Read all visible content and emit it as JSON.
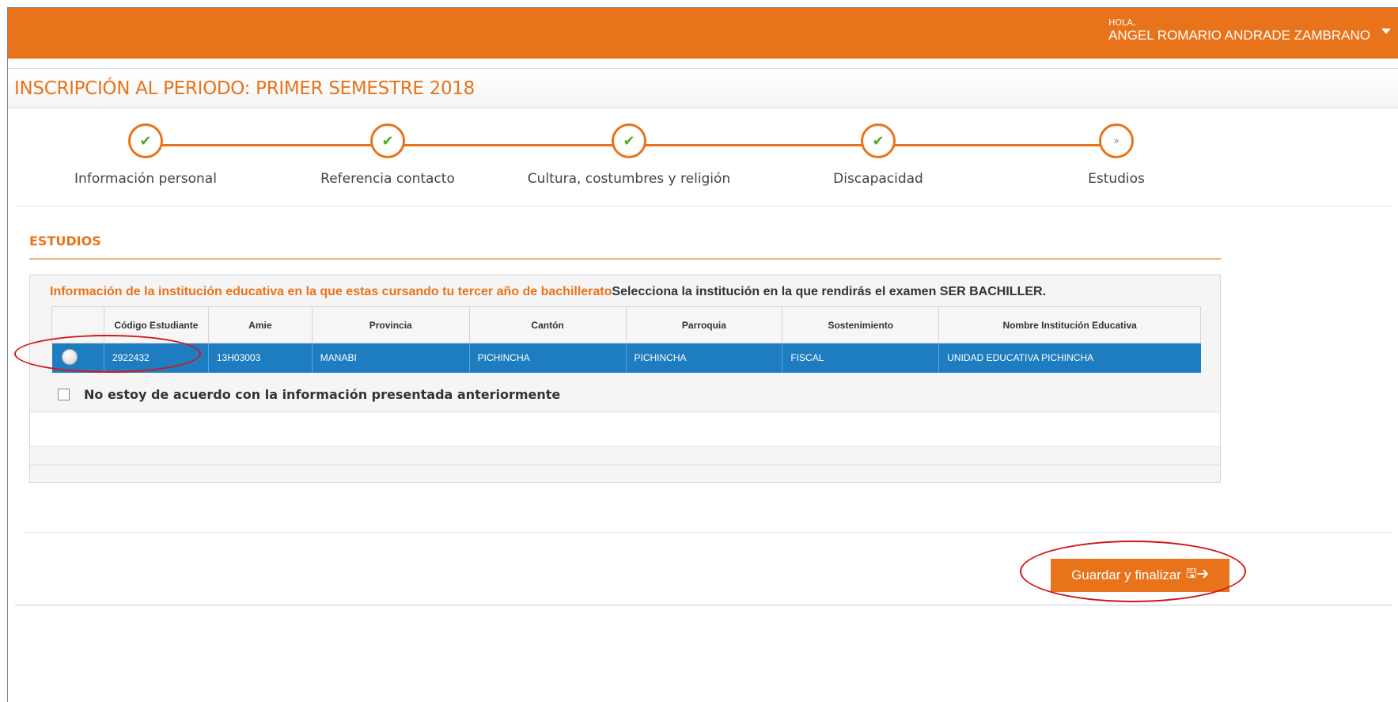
{
  "header": {
    "greeting": "HOLA,",
    "user_name": "ANGEL ROMARIO ANDRADE ZAMBRANO",
    "caret_icon": "caret-down-icon"
  },
  "page": {
    "title": "INSCRIPCIÓN AL PERIODO: PRIMER SEMESTRE 2018"
  },
  "wizard": {
    "steps": [
      {
        "label": "Información personal",
        "state": "done",
        "icon": "check-icon",
        "glyph": "✔"
      },
      {
        "label": "Referencia contacto",
        "state": "done",
        "icon": "check-icon",
        "glyph": "✔"
      },
      {
        "label": "Cultura, costumbres y religión",
        "state": "done",
        "icon": "check-icon",
        "glyph": "✔"
      },
      {
        "label": "Discapacidad",
        "state": "done",
        "icon": "check-icon",
        "glyph": "✔"
      },
      {
        "label": "Estudios",
        "state": "current",
        "icon": "chevron-double-right-icon",
        "glyph": "»"
      }
    ]
  },
  "section": {
    "title": "ESTUDIOS",
    "heading_orange": "Información de la institución educativa en la que estas cursando tu tercer año de bachillerato",
    "heading_dark": "Selecciona la institución en la que rendirás el examen SER BACHILLER."
  },
  "table": {
    "columns": [
      "",
      "Código Estudiante",
      "Amie",
      "Provincia",
      "Cantón",
      "Parroquia",
      "Sostenimiento",
      "Nombre Institución Educativa"
    ],
    "rows": [
      [
        "",
        "2922432",
        "13H03003",
        "MANABI",
        "PICHINCHA",
        "PICHINCHA",
        "FISCAL",
        "UNIDAD EDUCATIVA PICHINCHA"
      ]
    ]
  },
  "disagree_label": "No estoy de acuerdo con la información presentada anteriormente",
  "save_button": {
    "label": "Guardar y finalizar",
    "icons": "🖫➔"
  },
  "colors": {
    "brand_orange": "#e8731a",
    "selected_row_blue": "#1e7dc1",
    "annotation_red": "#d41515"
  }
}
